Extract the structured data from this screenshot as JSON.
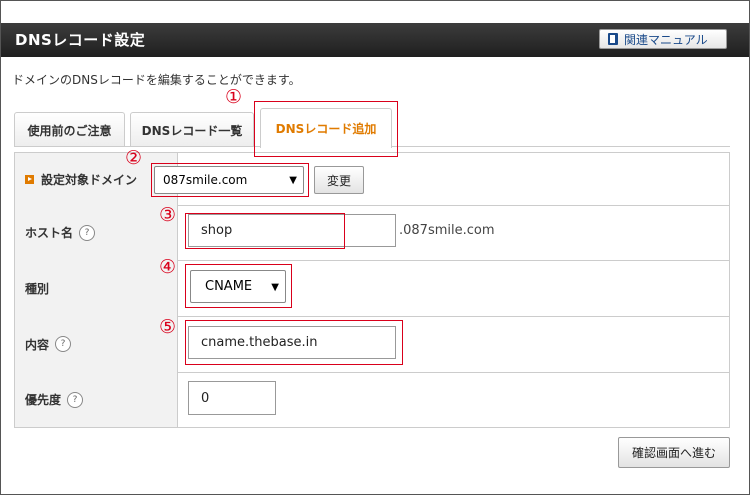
{
  "header": {
    "title": "DNSレコード設定",
    "manual_label": "関連マニュアル"
  },
  "description": "ドメインのDNSレコードを編集することができます。",
  "tabs": [
    {
      "label": "使用前のご注意",
      "active": false
    },
    {
      "label": "DNSレコード一覧",
      "active": false
    },
    {
      "label": "DNSレコード追加",
      "active": true
    }
  ],
  "form": {
    "domain": {
      "label": "設定対象ドメイン",
      "value": "087smile.com",
      "change_button": "変更"
    },
    "host": {
      "label": "ホスト名",
      "value": "shop",
      "suffix": ".087smile.com",
      "help": "?"
    },
    "type": {
      "label": "種別",
      "value": "CNAME"
    },
    "content": {
      "label": "内容",
      "value": "cname.thebase.in",
      "help": "?"
    },
    "priority": {
      "label": "優先度",
      "value": "0",
      "help": "?"
    }
  },
  "confirm_button": "確認画面へ進む",
  "annotations": [
    "①",
    "②",
    "③",
    "④",
    "⑤"
  ],
  "colors": {
    "accent": "#e07b00",
    "annotation": "#d9001b",
    "header": "#2b2b2b"
  }
}
